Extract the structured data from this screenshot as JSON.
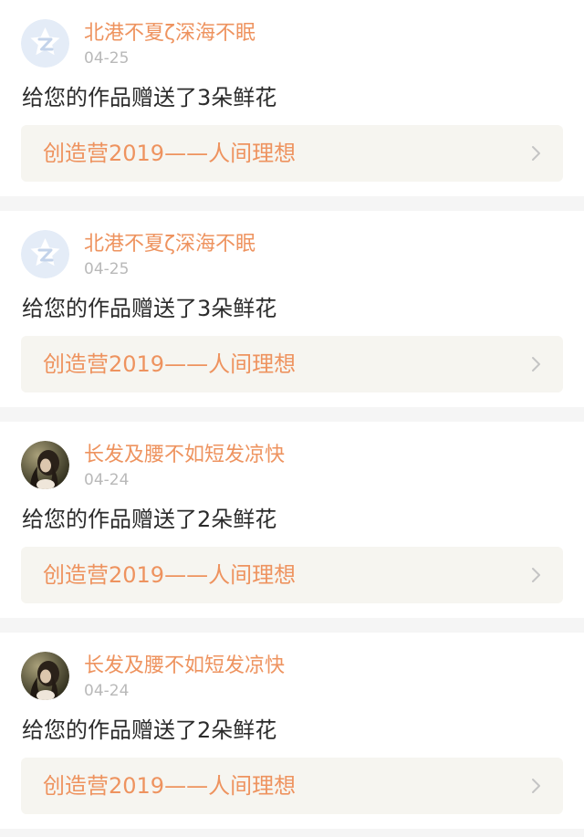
{
  "feed": {
    "items": [
      {
        "username": "北港不夏ζ深海不眠",
        "date": "04-25",
        "message": "给您的作品赠送了3朵鲜花",
        "work_title": "创造营2019——人间理想",
        "avatar_icon": "qzone-default-avatar-icon"
      },
      {
        "username": "北港不夏ζ深海不眠",
        "date": "04-25",
        "message": "给您的作品赠送了3朵鲜花",
        "work_title": "创造营2019——人间理想",
        "avatar_icon": "qzone-default-avatar-icon"
      },
      {
        "username": "长发及腰不如短发凉快",
        "date": "04-24",
        "message": "给您的作品赠送了2朵鲜花",
        "work_title": "创造营2019——人间理想",
        "avatar_icon": "user-photo-avatar"
      },
      {
        "username": "长发及腰不如短发凉快",
        "date": "04-24",
        "message": "给您的作品赠送了2朵鲜花",
        "work_title": "创造营2019——人间理想",
        "avatar_icon": "user-photo-avatar"
      }
    ]
  },
  "colors": {
    "accent": "#ee935f",
    "date_gray": "#b9b9b9",
    "text_dark": "#2b2b2b",
    "link_bg": "#f6f5f0",
    "separator": "#f5f5f5"
  }
}
